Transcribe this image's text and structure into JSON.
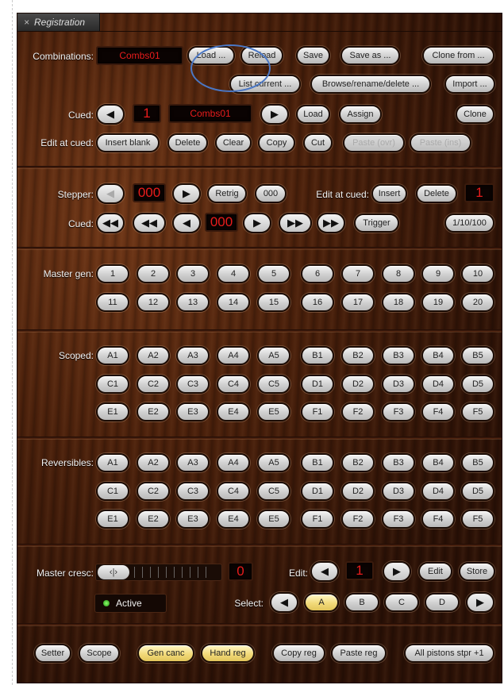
{
  "window": {
    "close_icon": "×",
    "title": "Registration"
  },
  "combinations": {
    "label": "Combinations:",
    "current": "Combs01",
    "buttons": [
      "Load ...",
      "Reload",
      "Save",
      "Save as ...",
      "Clone from ..."
    ],
    "buttons2": [
      "List current ...",
      "Browse/rename/delete ...",
      "Import ..."
    ]
  },
  "cued": {
    "label": "Cued:",
    "number": "1",
    "name": "Combs01",
    "load": "Load",
    "assign": "Assign",
    "clone": "Clone"
  },
  "edit_at_cued": {
    "label": "Edit at cued:",
    "buttons": [
      {
        "label": "Insert blank",
        "enabled": true
      },
      {
        "label": "Delete",
        "enabled": true
      },
      {
        "label": "Clear",
        "enabled": true
      },
      {
        "label": "Copy",
        "enabled": true
      },
      {
        "label": "Cut",
        "enabled": true
      },
      {
        "label": "Paste (ovr)",
        "enabled": false
      },
      {
        "label": "Paste (ins)",
        "enabled": false
      }
    ]
  },
  "stepper": {
    "label": "Stepper:",
    "value": "000",
    "retrig": "Retrig",
    "zero": "000",
    "edit_label": "Edit at cued:",
    "insert": "Insert",
    "delete": "Delete",
    "edit_value": "1",
    "cued_label": "Cued:",
    "cued_value": "000",
    "trigger": "Trigger",
    "step_sizes": "1/10/100"
  },
  "master_gen": {
    "label": "Master gen:",
    "pistons": [
      "1",
      "2",
      "3",
      "4",
      "5",
      "6",
      "7",
      "8",
      "9",
      "10",
      "11",
      "12",
      "13",
      "14",
      "15",
      "16",
      "17",
      "18",
      "19",
      "20"
    ]
  },
  "scoped": {
    "label": "Scoped:",
    "pistons": [
      "A1",
      "A2",
      "A3",
      "A4",
      "A5",
      "B1",
      "B2",
      "B3",
      "B4",
      "B5",
      "C1",
      "C2",
      "C3",
      "C4",
      "C5",
      "D1",
      "D2",
      "D3",
      "D4",
      "D5",
      "E1",
      "E2",
      "E3",
      "E4",
      "E5",
      "F1",
      "F2",
      "F3",
      "F4",
      "F5"
    ]
  },
  "reversibles": {
    "label": "Reversibles:",
    "pistons": [
      "A1",
      "A2",
      "A3",
      "A4",
      "A5",
      "B1",
      "B2",
      "B3",
      "B4",
      "B5",
      "C1",
      "C2",
      "C3",
      "C4",
      "C5",
      "D1",
      "D2",
      "D3",
      "D4",
      "D5",
      "E1",
      "E2",
      "E3",
      "E4",
      "E5",
      "F1",
      "F2",
      "F3",
      "F4",
      "F5"
    ]
  },
  "master_cresc": {
    "label": "Master cresc:",
    "slider_glyph": "‹|›",
    "value": "0",
    "active_label": "Active",
    "edit_label": "Edit:",
    "edit_value": "1",
    "edit_button": "Edit",
    "store_button": "Store",
    "select_label": "Select:",
    "select_options": [
      "A",
      "B",
      "C",
      "D"
    ],
    "selected": "A"
  },
  "footer": {
    "buttons": [
      {
        "label": "Setter",
        "highlight": false
      },
      {
        "label": "Scope",
        "highlight": false
      },
      {
        "label": "Gen canc",
        "highlight": true
      },
      {
        "label": "Hand reg",
        "highlight": true
      },
      {
        "label": "Copy reg",
        "highlight": false
      },
      {
        "label": "Paste reg",
        "highlight": false
      },
      {
        "label": "All pistons stpr +1",
        "highlight": false
      }
    ]
  },
  "icons": {
    "prev": "◀",
    "next": "▶",
    "fast_prev": "◀◀",
    "fast_next": "▶▶"
  },
  "colors": {
    "wood": "#3b1a0a",
    "display_text": "#e81c1c",
    "highlight": "#f2da7a",
    "annotation": "#4a77c5"
  }
}
